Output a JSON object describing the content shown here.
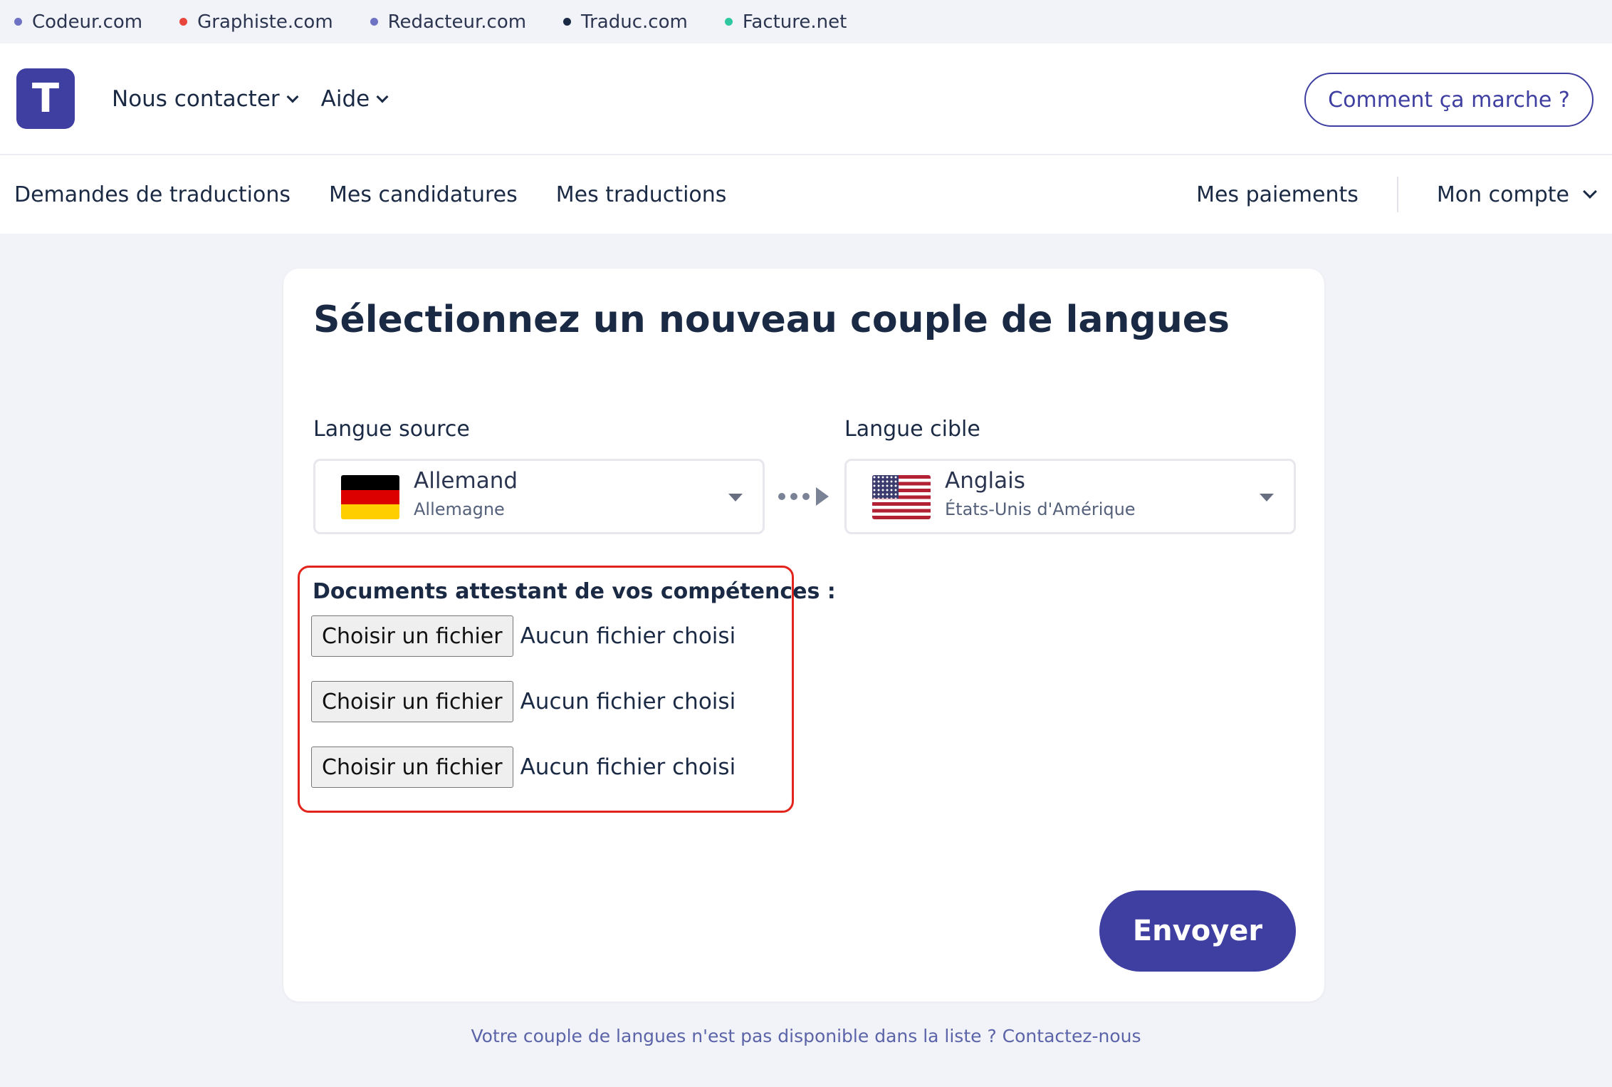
{
  "netbar": {
    "links": [
      {
        "label": "Codeur.com",
        "color": "#6e72c4"
      },
      {
        "label": "Graphiste.com",
        "color": "#e8453c"
      },
      {
        "label": "Redacteur.com",
        "color": "#6e72c4"
      },
      {
        "label": "Traduc.com",
        "color": "#1b2a44"
      },
      {
        "label": "Facture.net",
        "color": "#2dc7a0"
      }
    ]
  },
  "header": {
    "logo_letter": "T",
    "nav": [
      "Nous contacter",
      "Aide"
    ],
    "how_button": "Comment ça marche ?"
  },
  "mainnav": {
    "left": [
      "Demandes de traductions",
      "Mes candidatures",
      "Mes traductions"
    ],
    "payments": "Mes paiements",
    "account": "Mon compte"
  },
  "card": {
    "title": "Sélectionnez un nouveau couple de langues",
    "source": {
      "label": "Langue source",
      "language": "Allemand",
      "country": "Allemagne",
      "flag": "flag-germany"
    },
    "target": {
      "label": "Langue cible",
      "language": "Anglais",
      "country": "États-Unis d'Amérique",
      "flag": "flag-usa"
    },
    "docs": {
      "title": "Documents attestant de vos compétences :",
      "files": [
        {
          "button": "Choisir un fichier",
          "status": "Aucun fichier choisi"
        },
        {
          "button": "Choisir un fichier",
          "status": "Aucun fichier choisi"
        },
        {
          "button": "Choisir un fichier",
          "status": "Aucun fichier choisi"
        }
      ]
    },
    "submit": "Envoyer"
  },
  "footer": {
    "link": "Votre couple de langues n'est pas disponible dans la liste ? Contactez-nous"
  },
  "colors": {
    "brand": "#3e3fa1",
    "highlight": "#e3241d",
    "text": "#1b2a44"
  }
}
